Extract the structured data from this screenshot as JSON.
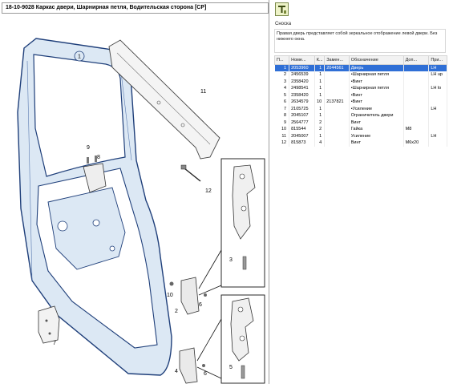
{
  "title": "18-10-9028 Каркас двери, Шарнирная петля, Водительская сторона [CP]",
  "toolbar": {
    "icon": "text-tool-icon",
    "label": "T"
  },
  "note": {
    "label": "Сноска",
    "text": "Правая дверь представляет собой зеркальное отображение левой двери. Без нижнего окна."
  },
  "table": {
    "columns": [
      "П...",
      "Номе...",
      "К...",
      "Замен...",
      "Обозначение",
      "Доп...",
      "При..."
    ],
    "rows": [
      [
        "1",
        "2053960",
        "1",
        "2044561",
        "Дверь",
        "",
        "LH"
      ],
      [
        "2",
        "2456539",
        "1",
        "",
        "•Шарнирная петля",
        "",
        "LH up"
      ],
      [
        "3",
        "2358420",
        "1",
        "",
        "•Винт",
        "",
        ""
      ],
      [
        "4",
        "2498541",
        "1",
        "",
        "•Шарнирная петля",
        "",
        "LH lo"
      ],
      [
        "5",
        "2358420",
        "1",
        "",
        "•Винт",
        "",
        ""
      ],
      [
        "6",
        "2634579",
        "10",
        "2137821",
        "•Винт",
        "",
        ""
      ],
      [
        "7",
        "2105725",
        "1",
        "",
        "•Усиление",
        "",
        "LH"
      ],
      [
        "8",
        "2045107",
        "1",
        "",
        "Ограничитель двери",
        "",
        ""
      ],
      [
        "9",
        "2564777",
        "2",
        "",
        "Винт",
        "",
        ""
      ],
      [
        "10",
        "815544",
        "2",
        "",
        "Гайка",
        "M8",
        ""
      ],
      [
        "11",
        "2045007",
        "1",
        "",
        "Усиление",
        "",
        "LH"
      ],
      [
        "12",
        "815873",
        "4",
        "",
        "Винт",
        "M6x20",
        ""
      ]
    ],
    "selected_row": 0
  },
  "diagram": {
    "callouts": [
      "1",
      "2",
      "3",
      "4",
      "5",
      "6",
      "7",
      "8",
      "9",
      "10",
      "11",
      "12"
    ]
  },
  "colors": {
    "selection": "#2f6fd6",
    "door_fill": "#dce8f4",
    "door_stroke": "#1f3f7a"
  }
}
